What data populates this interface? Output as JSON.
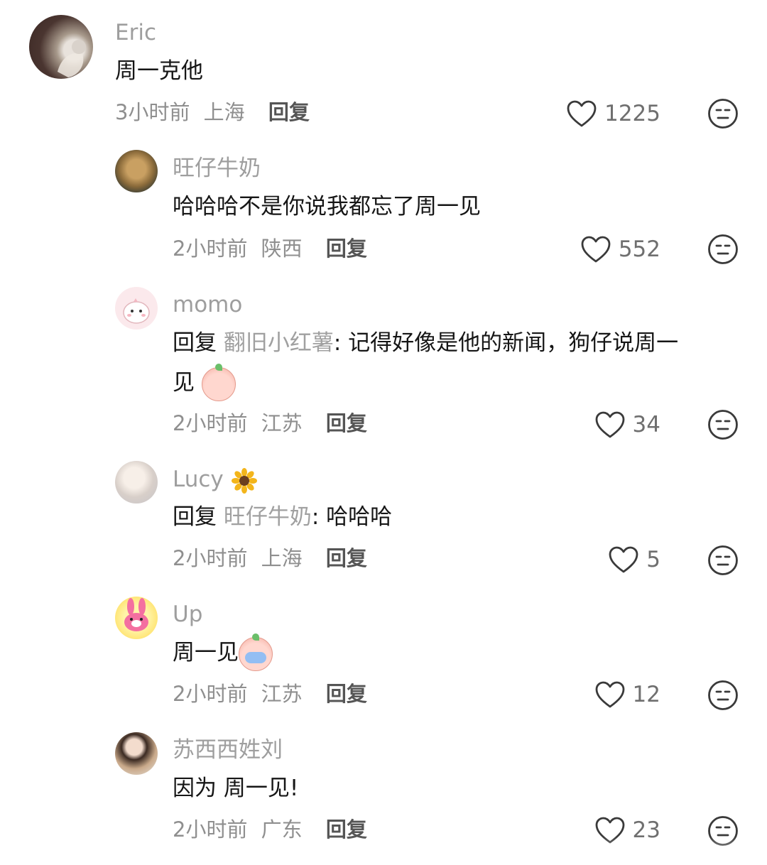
{
  "comments": [
    {
      "username": "Eric",
      "content": "周一克他",
      "time": "3小时前",
      "location": "上海",
      "reply_label": "回复",
      "likes": "1225",
      "avatar": "cat-photo-avatar"
    },
    {
      "username": "旺仔牛奶",
      "content": "哈哈哈不是你说我都忘了周一见",
      "time": "2小时前",
      "location": "陕西",
      "reply_label": "回复",
      "likes": "552",
      "avatar": "food-photo-avatar"
    },
    {
      "username": "momo",
      "reply_prefix": "回复",
      "mention": "翻旧小红薯",
      "content_line1": ": 记得好像是他的新闻，狗仔说周一",
      "content_line2": "见",
      "time": "2小时前",
      "location": "江苏",
      "reply_label": "回复",
      "likes": "34",
      "avatar": "cartoon-dinosaur-avatar"
    },
    {
      "username": "Lucy",
      "username_emoji": "sunflower",
      "reply_prefix": "回复",
      "mention": "旺仔牛奶",
      "content": ": 哈哈哈",
      "time": "2小时前",
      "location": "上海",
      "reply_label": "回复",
      "likes": "5",
      "avatar": "person-photo-avatar"
    },
    {
      "username": "Up",
      "content": "周一见",
      "time": "2小时前",
      "location": "江苏",
      "reply_label": "回复",
      "likes": "12",
      "avatar": "pink-bunny-avatar"
    },
    {
      "username": "苏西西姓刘",
      "content": "因为 周一见!",
      "time": "2小时前",
      "location": "广东",
      "reply_label": "回复",
      "likes": "23",
      "avatar": "woman-photo-avatar"
    }
  ],
  "icons": {
    "like": "heart-outline-icon",
    "dislike": "meh-face-icon"
  },
  "colors": {
    "username": "#9e9e9e",
    "text": "#161616",
    "meta": "#8f8f8f"
  }
}
